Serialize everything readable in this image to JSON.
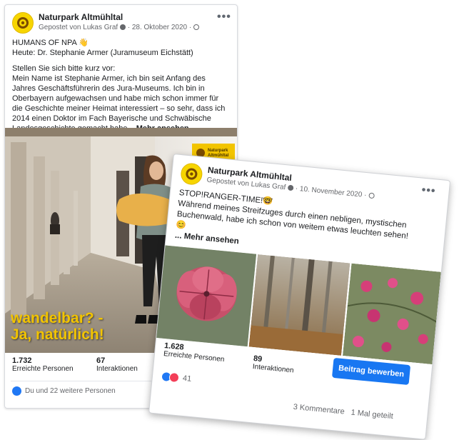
{
  "post1": {
    "page_name": "Naturpark Altmühltal",
    "meta": "Gepostet von Lukas Graf",
    "date": "28. Oktober 2020",
    "more": "•••",
    "heading": "HUMANS OF NPA 👋",
    "subheading": "Heute: Dr. Stephanie Armer (Juramuseum Eichstätt)",
    "question": "Stellen Sie sich bitte kurz vor:",
    "body": "Mein Name ist Stephanie Armer, ich bin seit Anfang des Jahres Geschäftsführerin des Jura-Museums. Ich bin in Oberbayern aufgewachsen und habe mich schon immer für die Geschichte meiner Heimat interessiert – so sehr, dass ich 2014 einen Doktor im Fach Bayerische und Schwäbische Landesgeschichte gemacht habe...",
    "see_more": "Mehr ansehen",
    "overlay_line1": "wandelbar? -",
    "overlay_line2": "Ja, natürlich!",
    "badge_text": "Naturpark Altmühltal",
    "reach_value": "1.732",
    "reach_label": "Erreichte Personen",
    "interactions_value": "67",
    "interactions_label": "Interaktionen",
    "reactions_text": "Du und 22 weitere Personen"
  },
  "post2": {
    "page_name": "Naturpark Altmühltal",
    "meta": "Gepostet von Lukas Graf",
    "date": "10. November 2020",
    "more": "•••",
    "heading": "STOP!RANGER-TIME!🤓",
    "body": "Während meines Streifzuges durch einen nebligen, mystischen Buchenwald, habe ich schon von weitem etwas leuchten sehen!😊",
    "see_more": "... Mehr ansehen",
    "reach_value": "1.628",
    "reach_label": "Erreichte Personen",
    "interactions_value": "89",
    "interactions_label": "Interaktionen",
    "promote_button": "Beitrag bewerben",
    "reactions_count": "41",
    "comments": "3 Kommentare",
    "shares": "1 Mal geteilt"
  },
  "colors": {
    "accent_yellow": "#f2c400",
    "facebook_blue": "#1877f2",
    "like_blue": "#2078f4",
    "love_red": "#f33e58"
  }
}
